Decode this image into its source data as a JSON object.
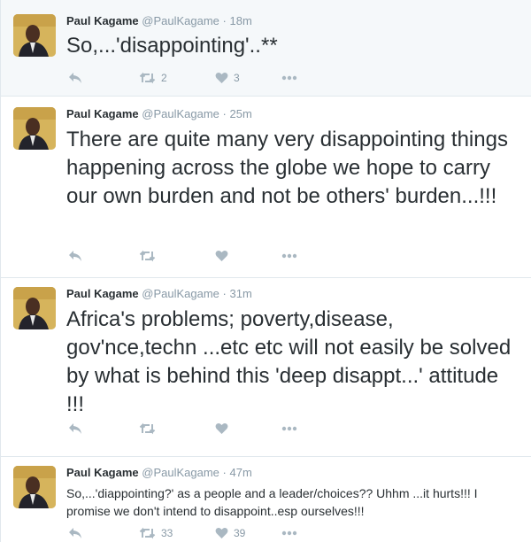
{
  "tweets": [
    {
      "name": "Paul Kagame",
      "handle": "@PaulKagame",
      "time": "· 18m",
      "text": "So,...'disappointing'..**",
      "retweets": "2",
      "likes": "3"
    },
    {
      "name": "Paul Kagame",
      "handle": "@PaulKagame",
      "time": "· 25m",
      "text": "There are quite many very disappointing things happening across the globe we hope to carry our own burden and not be others' burden...!!!",
      "retweets": "",
      "likes": ""
    },
    {
      "name": "Paul Kagame",
      "handle": "@PaulKagame",
      "time": "· 31m",
      "text": "Africa's problems; poverty,disease, gov'nce,techn ...etc etc will not easily be solved by what is behind this 'deep disappt...' attitude !!!",
      "retweets": "",
      "likes": ""
    },
    {
      "name": "Paul Kagame",
      "handle": "@PaulKagame",
      "time": "· 47m",
      "text": "So,...'diappointing?' as a people and a leader/choices?? Uhhm ...it hurts!!! I promise we don't intend to disappoint..esp ourselves!!!",
      "retweets": "33",
      "likes": "39"
    }
  ],
  "icons": {
    "reply": "reply-icon",
    "retweet": "retweet-icon",
    "like": "heart-icon",
    "more": "more-icon"
  },
  "colors": {
    "action_gray": "#aab8c2",
    "meta_gray": "#8899a6",
    "text": "#292f33",
    "highlight_bg": "#f5f8fa"
  }
}
